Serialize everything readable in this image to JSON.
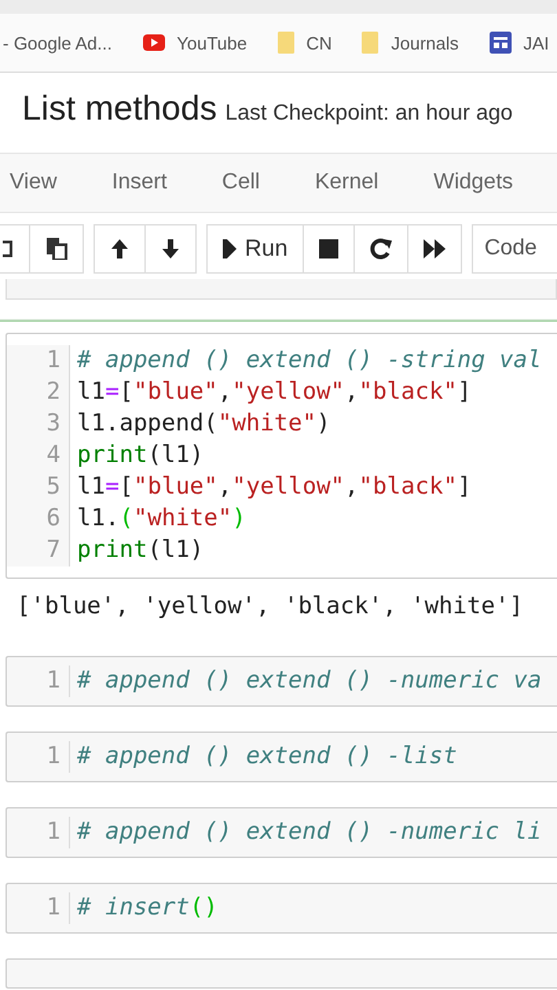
{
  "bookmarks": [
    {
      "kind": "plain",
      "label": "- Google Ad..."
    },
    {
      "kind": "video",
      "label": "YouTube"
    },
    {
      "kind": "folder",
      "label": "CN"
    },
    {
      "kind": "folder",
      "label": "Journals"
    },
    {
      "kind": "app",
      "label": "JAI"
    }
  ],
  "notebook": {
    "title": "List methods",
    "checkpoint": "Last Checkpoint: an hour ago"
  },
  "menu": [
    "View",
    "Insert",
    "Cell",
    "Kernel",
    "Widgets"
  ],
  "toolbar": {
    "run_label": "Run",
    "cell_type": "Code"
  },
  "cells": [
    {
      "selected": true,
      "lines": [
        {
          "number": "1",
          "tokens": [
            {
              "kind": "comment",
              "text": "# append () extend () -string val"
            }
          ]
        },
        {
          "number": "2",
          "tokens": [
            {
              "kind": "name",
              "text": "l1"
            },
            {
              "kind": "op",
              "text": "="
            },
            {
              "kind": "punct",
              "text": "["
            },
            {
              "kind": "string",
              "text": "\"blue\""
            },
            {
              "kind": "punct",
              "text": ","
            },
            {
              "kind": "string",
              "text": "\"yellow\""
            },
            {
              "kind": "punct",
              "text": ","
            },
            {
              "kind": "string",
              "text": "\"black\""
            },
            {
              "kind": "punct",
              "text": "]"
            }
          ]
        },
        {
          "number": "3",
          "tokens": [
            {
              "kind": "name",
              "text": "l1.append("
            },
            {
              "kind": "string",
              "text": "\"white\""
            },
            {
              "kind": "punct",
              "text": ")"
            }
          ]
        },
        {
          "number": "4",
          "tokens": [
            {
              "kind": "builtin",
              "text": "print"
            },
            {
              "kind": "punct",
              "text": "(l1)"
            }
          ]
        },
        {
          "number": "5",
          "tokens": [
            {
              "kind": "name",
              "text": "l1"
            },
            {
              "kind": "op",
              "text": "="
            },
            {
              "kind": "punct",
              "text": "["
            },
            {
              "kind": "string",
              "text": "\"blue\""
            },
            {
              "kind": "punct",
              "text": ","
            },
            {
              "kind": "string",
              "text": "\"yellow\""
            },
            {
              "kind": "punct",
              "text": ","
            },
            {
              "kind": "string",
              "text": "\"black\""
            },
            {
              "kind": "punct",
              "text": "]"
            }
          ]
        },
        {
          "number": "6",
          "tokens": [
            {
              "kind": "name",
              "text": "l1."
            },
            {
              "kind": "match",
              "text": "("
            },
            {
              "kind": "string",
              "text": "\"white\""
            },
            {
              "kind": "match",
              "text": ")"
            }
          ]
        },
        {
          "number": "7",
          "tokens": [
            {
              "kind": "builtin",
              "text": "print"
            },
            {
              "kind": "punct",
              "text": "(l1)"
            }
          ]
        }
      ],
      "output": "['blue', 'yellow', 'black', 'white']"
    },
    {
      "selected": false,
      "lines": [
        {
          "number": "1",
          "tokens": [
            {
              "kind": "comment",
              "text": "# append () extend () -numeric va"
            }
          ]
        }
      ]
    },
    {
      "selected": false,
      "lines": [
        {
          "number": "1",
          "tokens": [
            {
              "kind": "comment",
              "text": "# append () extend () -list"
            }
          ]
        }
      ]
    },
    {
      "selected": false,
      "lines": [
        {
          "number": "1",
          "tokens": [
            {
              "kind": "comment",
              "text": "# append () extend () -numeric li"
            }
          ]
        }
      ]
    },
    {
      "selected": false,
      "lines": [
        {
          "number": "1",
          "tokens": [
            {
              "kind": "comment",
              "text": "# insert"
            },
            {
              "kind": "match",
              "text": "()"
            }
          ]
        }
      ]
    }
  ]
}
